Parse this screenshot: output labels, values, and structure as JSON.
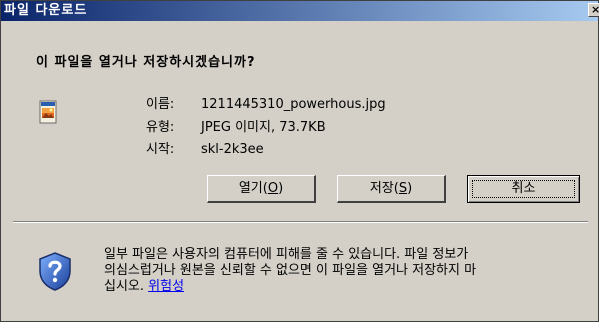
{
  "window": {
    "title": "파일 다운로드",
    "close_label": "×"
  },
  "dialog": {
    "question": "이 파일을 열거나 저장하시겠습니까?",
    "file_icon": "jpeg-file-icon",
    "info": {
      "name_label": "이름:",
      "name_value": "1211445310_powerhous.jpg",
      "type_label": "유형:",
      "type_value": "JPEG 이미지, 73.7KB",
      "from_label": "시작:",
      "from_value": "skl-2k3ee"
    },
    "buttons": {
      "open_label": "열기(",
      "open_key": "O",
      "open_end": ")",
      "save_label": "저장(",
      "save_key": "S",
      "save_end": ")",
      "cancel_label": "취소"
    },
    "warning": {
      "icon": "shield-question-icon",
      "text_1": "일부 파일은 사용자의 컴퓨터에 피해를 줄 수 있습니다. 파일 정보가",
      "text_2": "의심스럽거나 원본을 신뢰할 수 없으면 이 파일을 열거나 저장하지 마",
      "text_3": "십시오.",
      "link_text": "위험성"
    }
  }
}
